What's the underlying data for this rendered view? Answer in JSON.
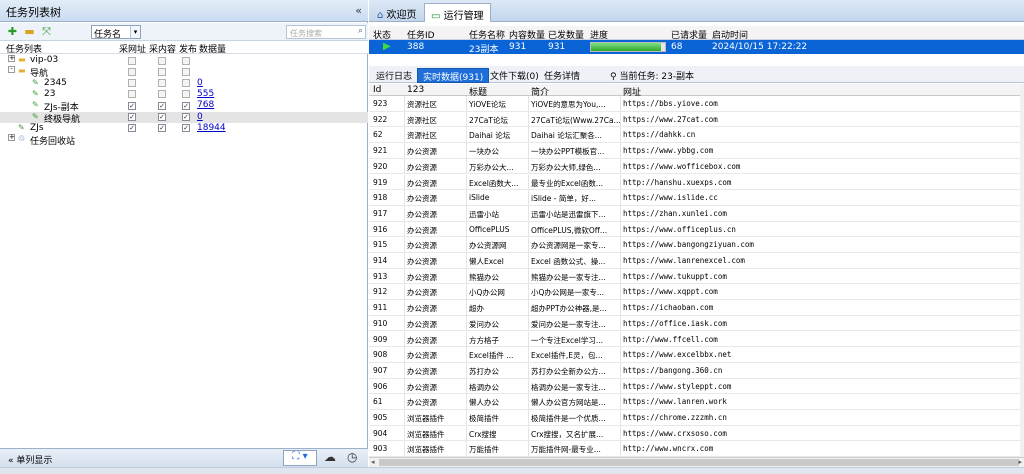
{
  "left_panel": {
    "title": "任务列表树",
    "collapse_glyph": "«",
    "dropdown_value": "任务名",
    "search_placeholder": "任务搜索",
    "columns": [
      "任务列表",
      "采网址",
      "采内容",
      "发布",
      "数据量"
    ],
    "tree": [
      {
        "indent": 0,
        "label": "vip-03",
        "icon": "folder-icon",
        "expander": "+",
        "count": ""
      },
      {
        "indent": 0,
        "label": "导航",
        "icon": "folder-icon",
        "expander": "-",
        "count": ""
      },
      {
        "indent": 1,
        "label": "2345",
        "icon": "task-icon",
        "expander": "",
        "count": "0"
      },
      {
        "indent": 1,
        "label": "23",
        "icon": "task-icon",
        "expander": "",
        "count": "555"
      },
      {
        "indent": 1,
        "label": "ZJs-副本",
        "icon": "task-icon",
        "expander": "",
        "count": "768"
      },
      {
        "indent": 1,
        "label": "终极导航",
        "icon": "task-icon",
        "expander": "",
        "count": "0"
      },
      {
        "indent": 0,
        "label": "ZJs",
        "icon": "task-icon",
        "expander": "",
        "count": "18944"
      },
      {
        "indent": 0,
        "label": "任务回收站",
        "icon": "recycle-icon",
        "expander": "+",
        "count": ""
      }
    ],
    "bottom_label": "单列显示",
    "bottom_glyph": "«"
  },
  "tabs": [
    "欢迎页",
    "运行管理"
  ],
  "task_table": {
    "headers": [
      "状态",
      "任务ID",
      "任务名称",
      "内容数量",
      "已发数量",
      "进度",
      "已请求量",
      "启动时间"
    ],
    "row": {
      "id": "388",
      "name": "23副本",
      "content": "931",
      "sent": "931",
      "progress": 0.95,
      "requested": "68",
      "start": "2024/10/15 17:22:22"
    }
  },
  "subtabs": [
    "运行日志",
    "实时数据(931)",
    "文件下载(0)",
    "任务详情",
    "当前任务: 23-副本"
  ],
  "grid": {
    "headers": [
      "Id",
      "123",
      "标题",
      "简介",
      "网址"
    ],
    "rows": [
      [
        "923",
        "资源社区",
        "YiOVE论坛",
        "YiOVE的意思为You,...",
        "https://bbs.yiove.com"
      ],
      [
        "922",
        "资源社区",
        "27CaT论坛",
        "27CaT论坛(Www.27Ca...",
        "https://www.27cat.com"
      ],
      [
        "62",
        "资源社区",
        "Daihai 论坛",
        "Daihai 论坛汇聚各...",
        "https://dahkk.cn"
      ],
      [
        "921",
        "办公资源",
        "一块办公",
        "一块办公PPT模板官...",
        "https://www.ybbg.com"
      ],
      [
        "920",
        "办公资源",
        "万彩办公大...",
        "万彩办公大师,绿色...",
        "https://www.wofficebox.com"
      ],
      [
        "919",
        "办公资源",
        "Excel函数大...",
        "最专业的Excel函数...",
        "http://hanshu.xuexps.com"
      ],
      [
        "918",
        "办公资源",
        "iSlide",
        "iSlide - 简单，好...",
        "https://www.islide.cc"
      ],
      [
        "917",
        "办公资源",
        "迅雷小站",
        "迅雷小站是迅雷旗下...",
        "https://zhan.xunlei.com"
      ],
      [
        "916",
        "办公资源",
        "OfficePLUS",
        "OfficePLUS,微软Off...",
        "https://www.officeplus.cn"
      ],
      [
        "915",
        "办公资源",
        "办公资源网",
        "办公资源网是一家专...",
        "https://www.bangongziyuan.com"
      ],
      [
        "914",
        "办公资源",
        "懒人Excel",
        "Excel 函数公式、操...",
        "https://www.lanrenexcel.com"
      ],
      [
        "913",
        "办公资源",
        "熊猫办公",
        "熊猫办公是一家专注...",
        "https://www.tukuppt.com"
      ],
      [
        "912",
        "办公资源",
        "小Q办公网",
        "小Q办公网是一家专...",
        "https://www.xqppt.com"
      ],
      [
        "911",
        "办公资源",
        "超办",
        "超办PPT办公神器,是...",
        "https://ichaoban.com"
      ],
      [
        "910",
        "办公资源",
        "爱问办公",
        "爱问办公是一家专注...",
        "https://office.iask.com"
      ],
      [
        "909",
        "办公资源",
        "方方格子",
        "一个专注Excel学习...",
        "http://www.ffcell.com"
      ],
      [
        "908",
        "办公资源",
        "Excel插件 ...",
        "Excel插件,E灵，包...",
        "https://www.excelbbx.net"
      ],
      [
        "907",
        "办公资源",
        "苏打办公",
        "苏打办公全新办公方...",
        "https://bangong.360.cn"
      ],
      [
        "906",
        "办公资源",
        "格调办公",
        "格调办公是一家专注...",
        "https://www.styleppt.com"
      ],
      [
        "61",
        "办公资源",
        "懒人办公",
        "懒人办公官方网站是...",
        "https://www.lanren.work"
      ],
      [
        "905",
        "浏览器插件",
        "极简插件",
        "极简插件是一个优质...",
        "https://chrome.zzzmh.cn"
      ],
      [
        "904",
        "浏览器插件",
        "Crx搜搜",
        "Crx搜搜，又名扩展...",
        "https://www.crxsoso.com"
      ],
      [
        "903",
        "浏览器插件",
        "万能插件",
        "万能插件网-最专业...",
        "http://www.wncrx.com"
      ]
    ]
  },
  "colors": {
    "accent": "#0a64d6",
    "tab_active": "#1e6fd9",
    "progress": "#2fa52f"
  }
}
